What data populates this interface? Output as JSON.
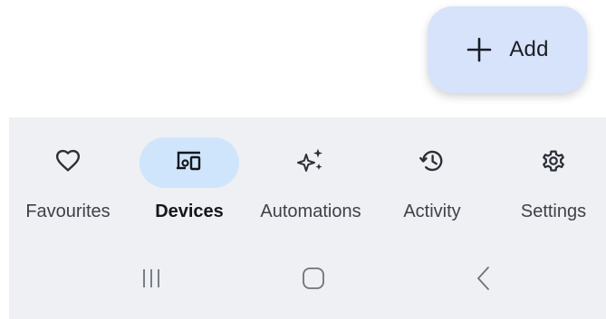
{
  "fab": {
    "label": "Add",
    "icon": "plus-icon",
    "color": "#d6e3fb"
  },
  "bottom_nav": {
    "active_color": "#cfe5fb",
    "items": [
      {
        "label": "Favourites",
        "icon": "heart-icon",
        "active": false
      },
      {
        "label": "Devices",
        "icon": "devices-icon",
        "active": true
      },
      {
        "label": "Automations",
        "icon": "sparkle-icon",
        "active": false
      },
      {
        "label": "Activity",
        "icon": "history-icon",
        "active": false
      },
      {
        "label": "Settings",
        "icon": "gear-icon",
        "active": false
      }
    ]
  },
  "system_nav": {
    "buttons": [
      {
        "icon": "recent-apps-icon"
      },
      {
        "icon": "home-icon"
      },
      {
        "icon": "back-icon"
      }
    ]
  }
}
